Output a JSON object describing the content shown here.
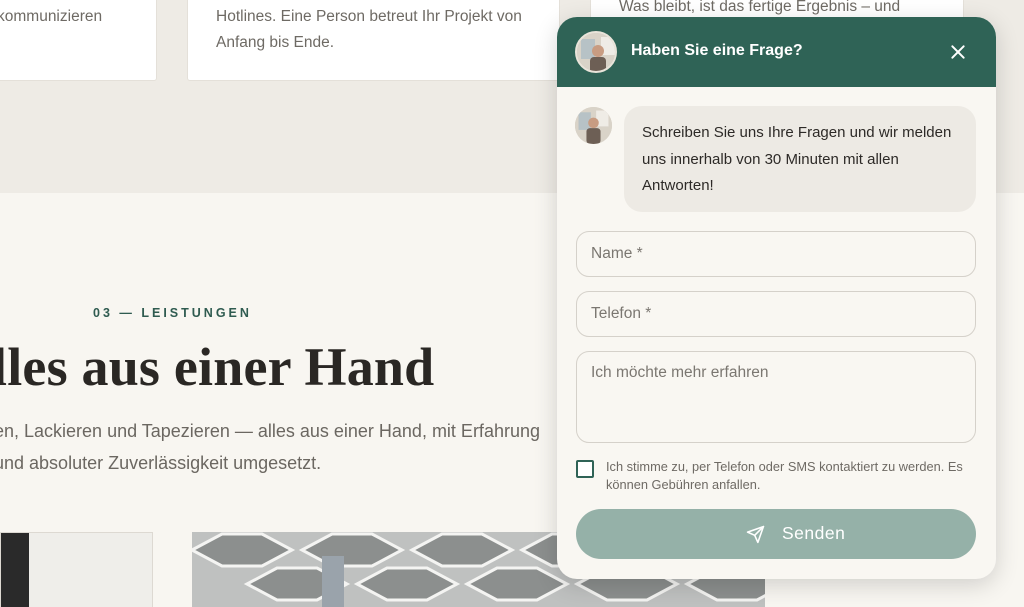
{
  "page": {
    "cards": [
      "kommunizieren",
      "Hotlines. Eine Person betreut Ihr Projekt von Anfang bis Ende.",
      "Was bleibt, ist das fertige Ergebnis – und"
    ],
    "section_label": "03 — LEISTUNGEN",
    "section_title": "lles aus einer Hand",
    "section_desc": "en, Lackieren und Tapezieren — alles aus einer Hand, mit Erfahrung und absoluter Zuverlässigkeit umgesetzt."
  },
  "chat": {
    "title": "Haben Sie eine Frage?",
    "message": "Schreiben Sie uns Ihre Fragen und wir melden uns innerhalb von 30 Minuten mit allen Antworten!",
    "fields": {
      "name_placeholder": "Name *",
      "phone_placeholder": "Telefon *",
      "message_placeholder": "Ich möchte mehr erfahren"
    },
    "consent_label": "Ich stimme zu, per Telefon oder SMS kontaktiert zu werden. Es können Gebühren anfallen.",
    "consent_checked": false,
    "send_label": "Senden",
    "icons": [
      "close-icon",
      "send-icon",
      "avatar"
    ]
  },
  "colors": {
    "header": "#2f6356",
    "send_button": "#95b1a8",
    "accent_text": "#2f5b50",
    "background": "#f8f6f1"
  }
}
